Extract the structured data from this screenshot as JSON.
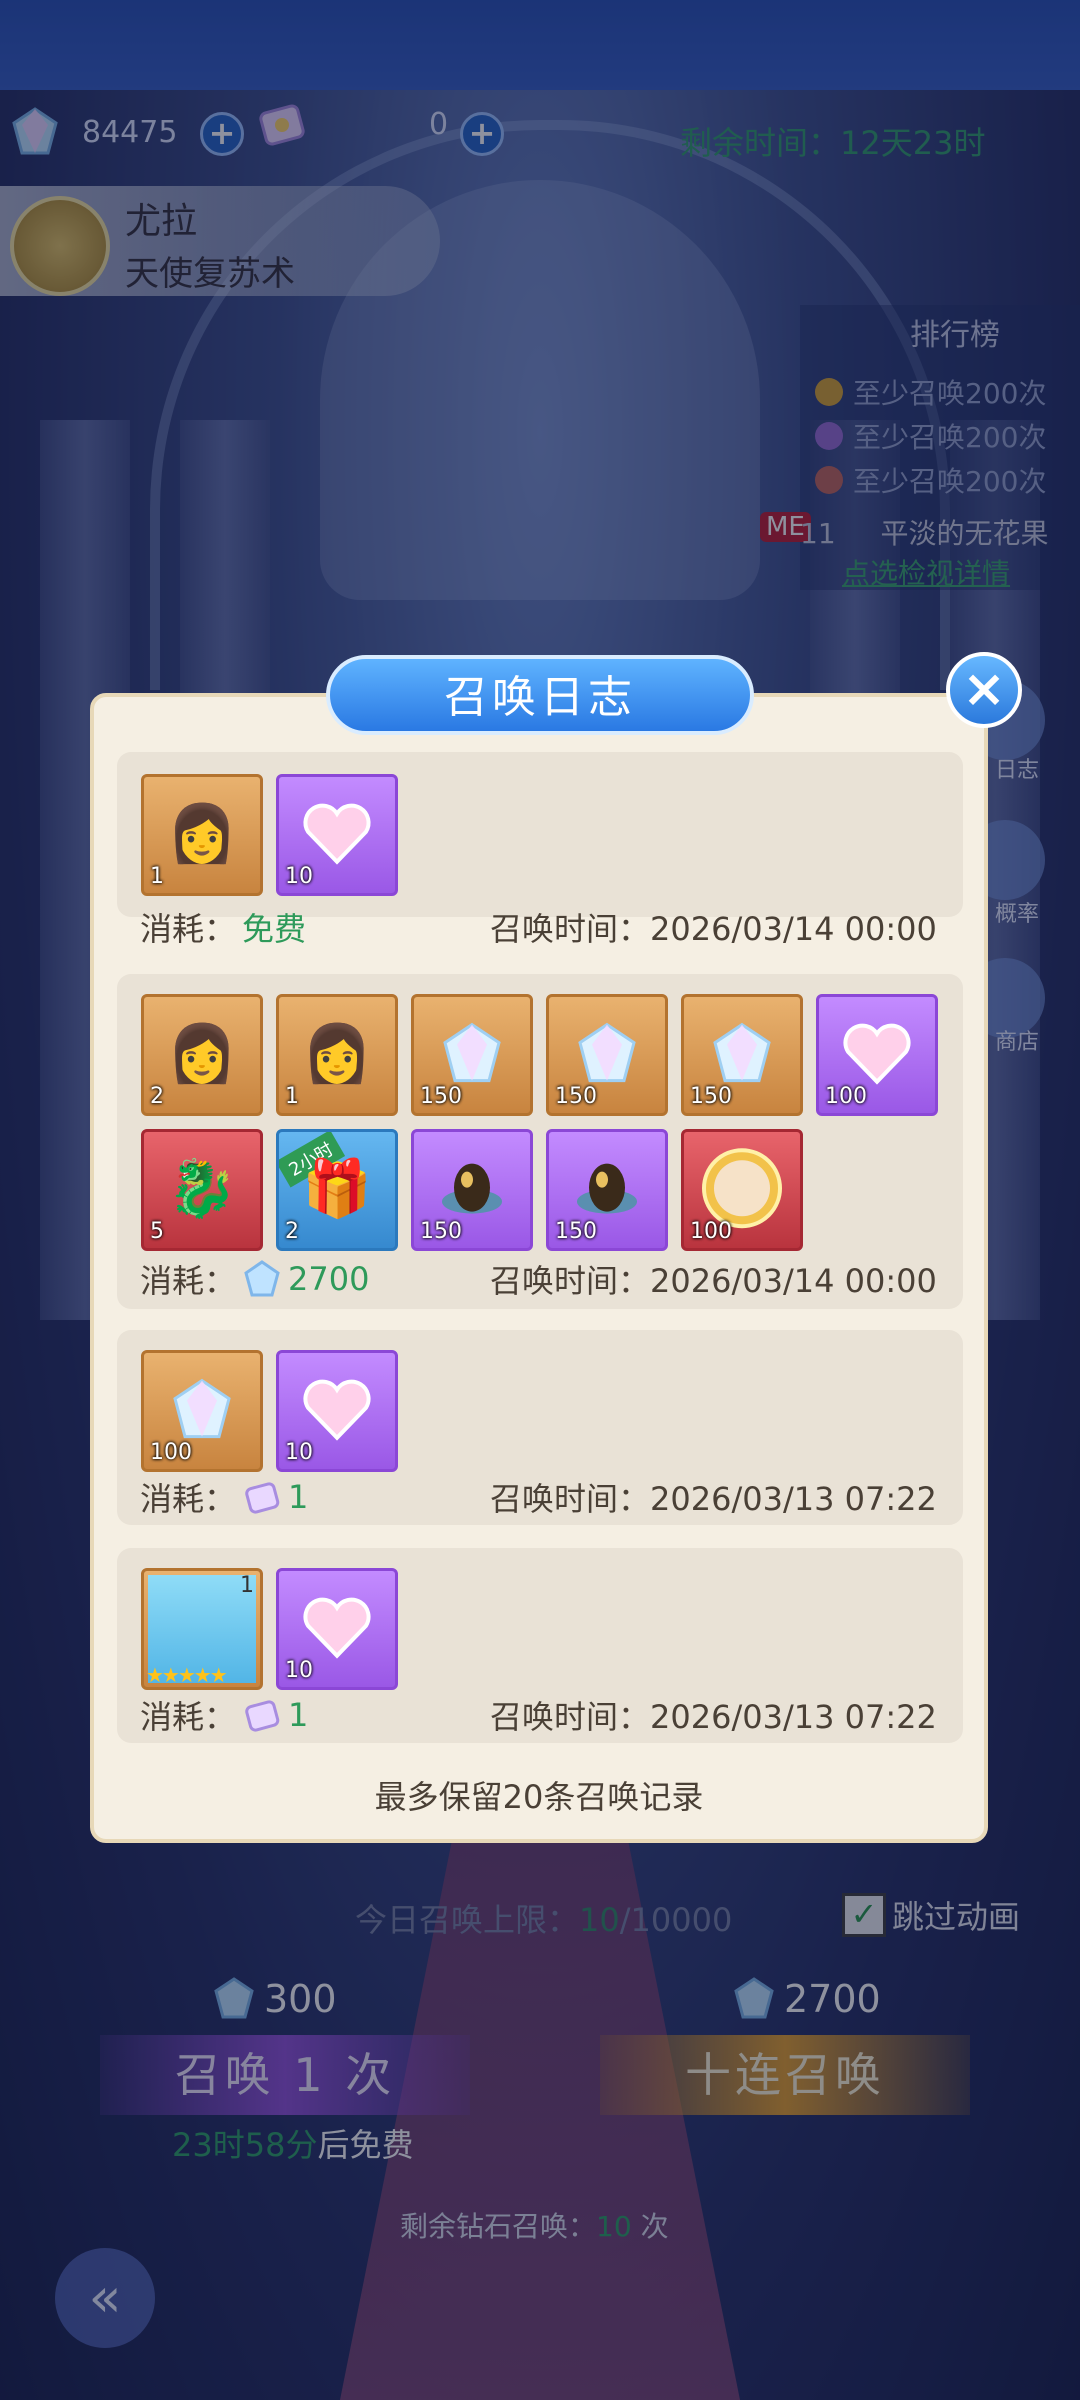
{
  "top": {
    "diamonds": "84475",
    "tickets": "0",
    "remaining_time": "剩余时间：12天23时"
  },
  "hero": {
    "name": "尤拉",
    "skill": "天使复苏术"
  },
  "ranking": {
    "title": "排行榜",
    "rows": [
      "至少召唤200次",
      "至少召唤200次",
      "至少召唤200次"
    ],
    "me_badge": "ME",
    "me_rank": "11",
    "me_name": "平淡的无花果",
    "detail_link": "点选检视详情"
  },
  "side": {
    "log": "日志",
    "rate": "概率",
    "shop": "商店"
  },
  "dialog": {
    "title": "召唤日志",
    "note": "最多保留20条召唤记录",
    "cost_label": "消耗：",
    "time_label": "召唤时间：",
    "records": [
      {
        "cost": "免费",
        "time": "2026/03/14 00:00",
        "items": [
          {
            "type": "hero-shard",
            "count": "1"
          },
          {
            "type": "purple-heart",
            "count": "10"
          }
        ]
      },
      {
        "cost": "2700",
        "time": "2026/03/14 00:00",
        "items": [
          {
            "type": "hero-shard",
            "count": "2"
          },
          {
            "type": "hero-shard",
            "count": "1"
          },
          {
            "type": "crystal",
            "count": "150"
          },
          {
            "type": "crystal",
            "count": "150"
          },
          {
            "type": "crystal",
            "count": "150"
          },
          {
            "type": "purple-heart",
            "count": "100"
          },
          {
            "type": "dragon",
            "count": "5"
          },
          {
            "type": "treasure-chest",
            "count": "2",
            "badge": "2小时"
          },
          {
            "type": "gold-egg",
            "count": "150"
          },
          {
            "type": "gold-egg",
            "count": "150"
          },
          {
            "type": "hero-medal",
            "count": "100"
          }
        ]
      },
      {
        "cost": "1",
        "time": "2026/03/13 07:22",
        "items": [
          {
            "type": "crystal",
            "count": "100"
          },
          {
            "type": "purple-heart",
            "count": "10"
          }
        ]
      },
      {
        "cost": "1",
        "time": "2026/03/13 07:22",
        "items": [
          {
            "type": "hero-card",
            "count": "1",
            "stars": 5
          },
          {
            "type": "purple-heart",
            "count": "10"
          }
        ]
      }
    ]
  },
  "bottom": {
    "limit_prefix": "今日召唤上限：",
    "limit_used": "10",
    "limit_total": "/10000",
    "skip_label": "跳过动画",
    "single_cost": "300",
    "ten_cost": "2700",
    "single_btn": "召唤 1 次",
    "ten_btn": "十连召唤",
    "free_time": "23时58分",
    "free_suffix": "后免费",
    "remain_prefix": "剩余钻石召唤：",
    "remain_count": "10",
    "remain_suffix": "次"
  },
  "colors": {
    "accent_green": "#2e9a5a",
    "dialog_bg": "#f5efe3",
    "title_blue": "#2a79e3"
  }
}
